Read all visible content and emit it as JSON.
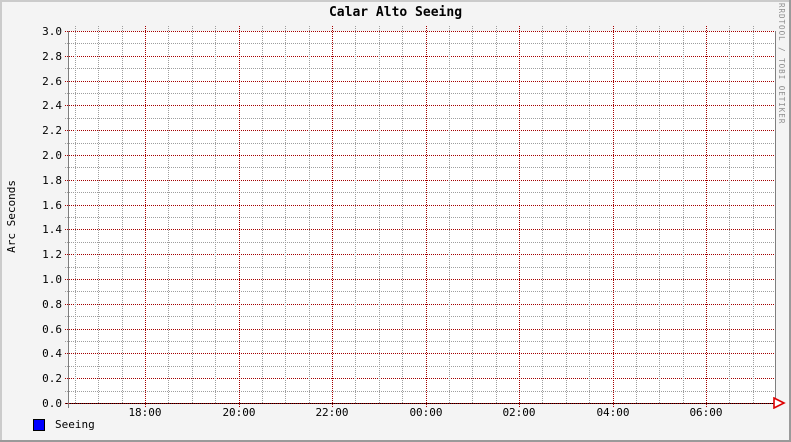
{
  "title": "Calar Alto Seeing",
  "watermark": "RRDTOOL / TOBI OETIKER",
  "legend": {
    "items": [
      {
        "label": "Seeing",
        "color": "#0000ff"
      }
    ]
  },
  "chart_data": {
    "type": "line",
    "title": "Calar Alto Seeing",
    "xlabel": "",
    "ylabel": "Arc Seconds",
    "ylim": [
      0.0,
      3.0
    ],
    "y_major_step": 0.2,
    "y_minor_step": 0.1,
    "y_ticks": [
      "0.0",
      "0.2",
      "0.4",
      "0.6",
      "0.8",
      "1.0",
      "1.2",
      "1.4",
      "1.6",
      "1.8",
      "2.0",
      "2.2",
      "2.4",
      "2.6",
      "2.8",
      "3.0"
    ],
    "x_ticks": [
      "18:00",
      "20:00",
      "22:00",
      "00:00",
      "02:00",
      "04:00",
      "06:00"
    ],
    "x_major_interval": "2h",
    "x_minor_interval": "30min",
    "grid": true,
    "legend_position": "bottom-left",
    "series": [
      {
        "name": "Seeing",
        "color": "#0000ff",
        "values": []
      }
    ],
    "colors": {
      "background": "#f4f4f4",
      "canvas": "#ffffff",
      "major_grid": "#a40000",
      "minor_grid": "#9e9e9e",
      "axis": "#7f7f7f",
      "x_axis": "#000000",
      "arrow": "#dd0000",
      "shade_light": "#cbcbcb",
      "shade_dark": "#9a9a9a"
    }
  }
}
